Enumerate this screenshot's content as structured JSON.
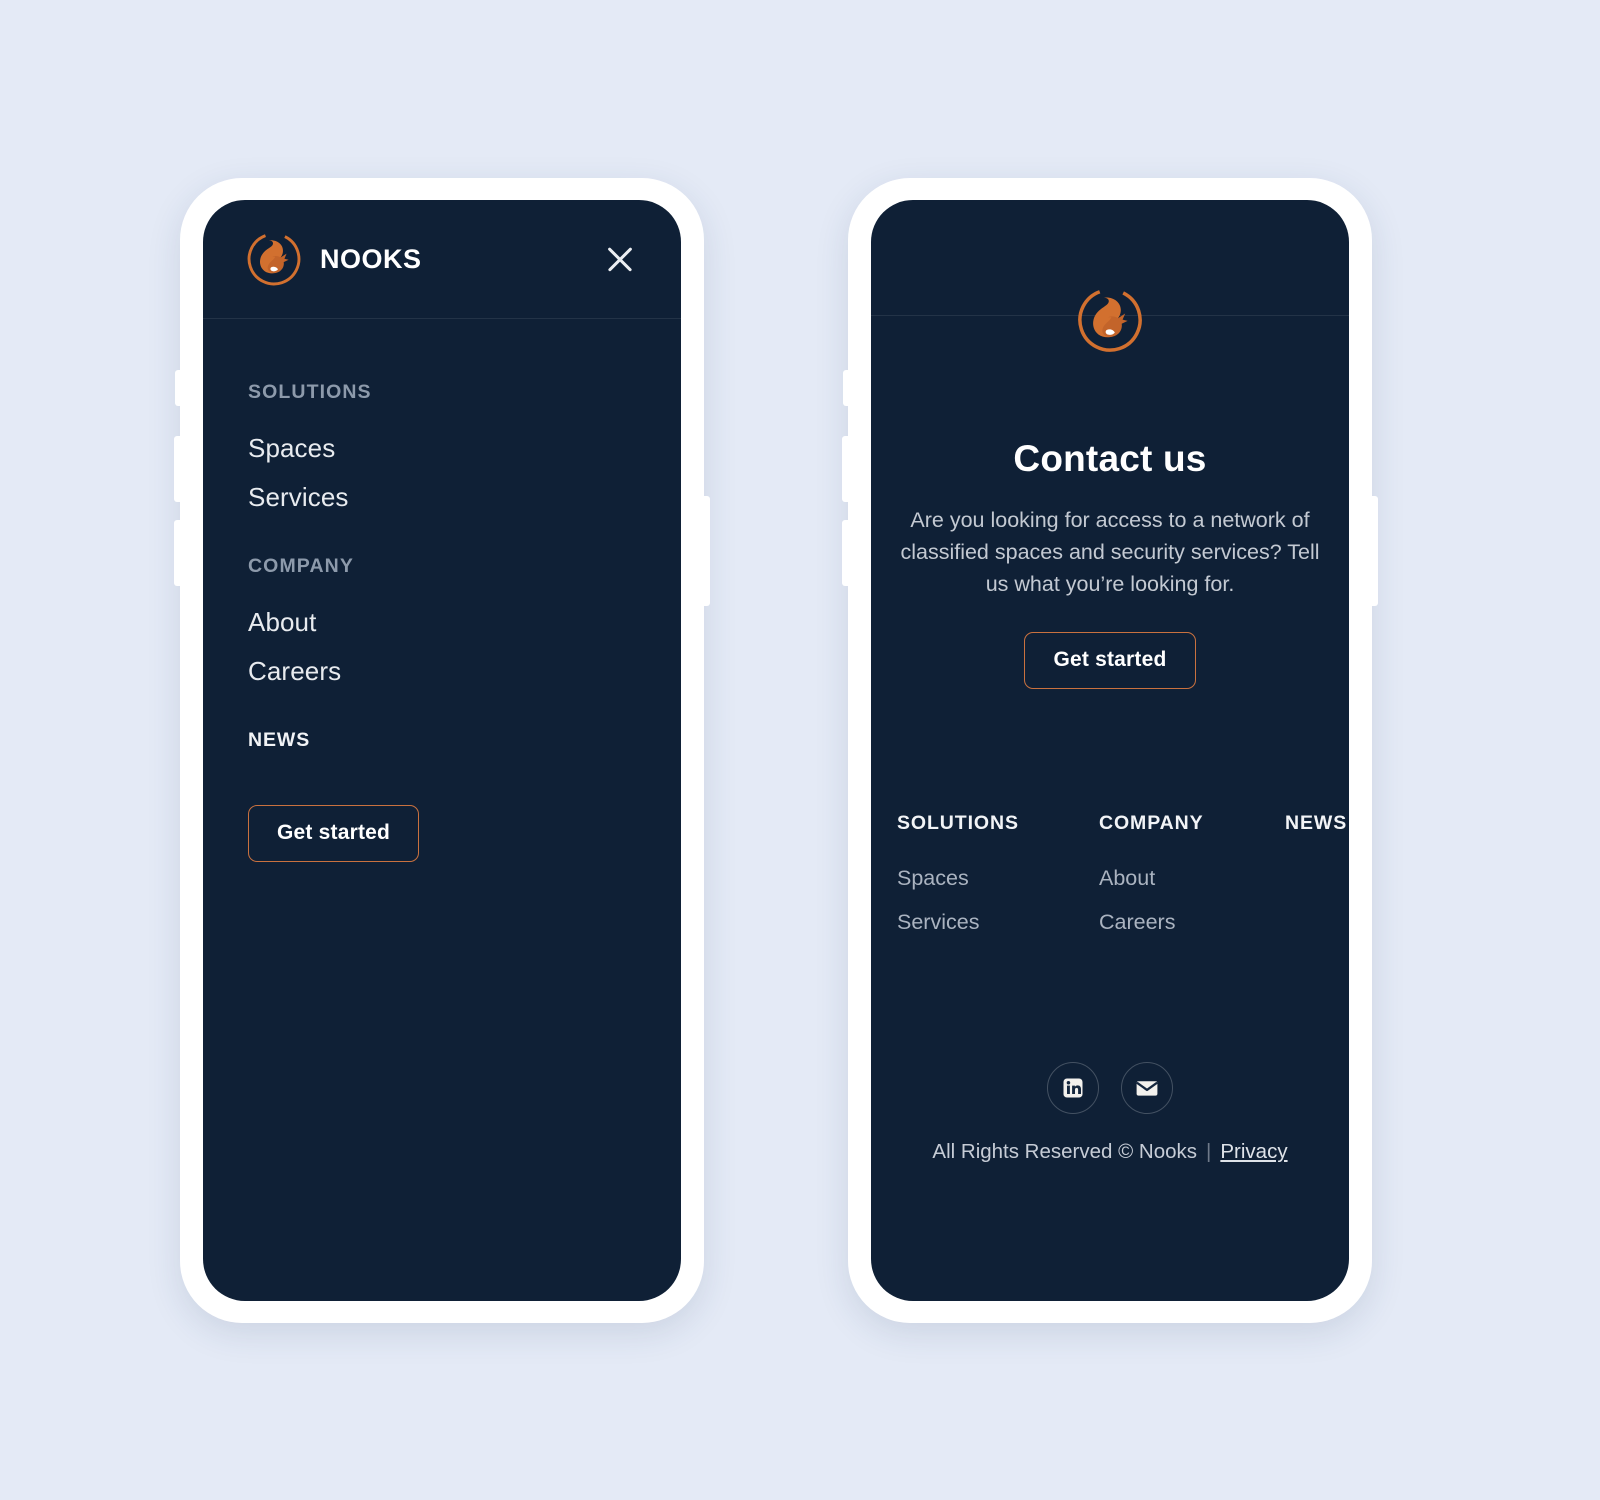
{
  "theme": {
    "page_background": "#e4eaf6",
    "screen_background": "#0f2036",
    "accent": "#c9713f",
    "logo_orange": "#d2702f",
    "muted_text": "#8d9aab",
    "body_text": "#c3c9d2"
  },
  "menu_screen": {
    "brand_name": "NOOKS",
    "logo_icon": "squirrel-logo-icon",
    "close_icon": "close-icon",
    "groups": [
      {
        "title": "SOLUTIONS",
        "links": [
          "Spaces",
          "Services"
        ]
      },
      {
        "title": "COMPANY",
        "links": [
          "About",
          "Careers"
        ]
      },
      {
        "title": "NEWS",
        "links": []
      }
    ],
    "cta_label": "Get started"
  },
  "contact_screen": {
    "logo_icon": "squirrel-logo-icon",
    "title": "Contact us",
    "description": "Are you looking for access to a network of classified spaces and security services? Tell us what you’re looking for.",
    "cta_label": "Get started",
    "footer": {
      "columns": [
        {
          "title": "SOLUTIONS",
          "links": [
            "Spaces",
            "Services"
          ]
        },
        {
          "title": "COMPANY",
          "links": [
            "About",
            "Careers"
          ]
        },
        {
          "title": "NEWS",
          "links": []
        }
      ],
      "social": [
        {
          "name": "linkedin-icon",
          "label": "LinkedIn"
        },
        {
          "name": "email-icon",
          "label": "Email"
        }
      ],
      "copyright": "All Rights Reserved © Nooks",
      "separator": "|",
      "privacy_label": "Privacy"
    }
  }
}
